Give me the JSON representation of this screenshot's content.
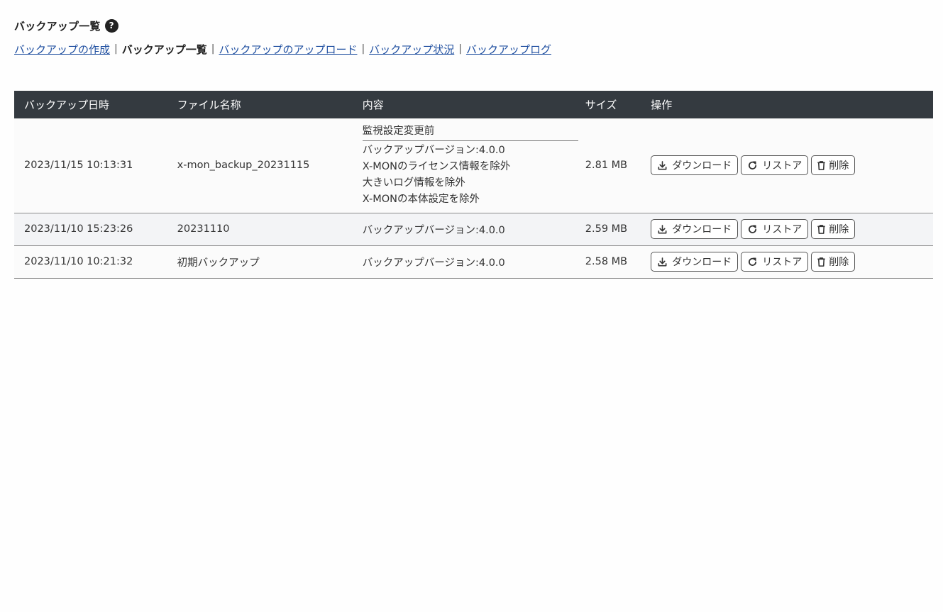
{
  "header": {
    "title": "バックアップ一覧",
    "help_symbol": "?"
  },
  "nav": {
    "separator": "|",
    "items": [
      {
        "label": "バックアップの作成",
        "current": false
      },
      {
        "label": "バックアップ一覧",
        "current": true
      },
      {
        "label": "バックアップのアップロード",
        "current": false
      },
      {
        "label": "バックアップ状況",
        "current": false
      },
      {
        "label": "バックアップログ",
        "current": false
      }
    ]
  },
  "table": {
    "columns": [
      "バックアップ日時",
      "ファイル名称",
      "内容",
      "サイズ",
      "操作"
    ],
    "rows": [
      {
        "datetime": "2023/11/15 10:13:31",
        "filename": "x-mon_backup_20231115",
        "memo": "監視設定変更前",
        "content": [
          "バックアップバージョン:4.0.0",
          "X-MONのライセンス情報を除外",
          "大きいログ情報を除外",
          "X-MONの本体設定を除外"
        ],
        "size": "2.81 MB"
      },
      {
        "datetime": "2023/11/10 15:23:26",
        "filename": "20231110",
        "memo": "",
        "content": [
          "バックアップバージョン:4.0.0"
        ],
        "size": "2.59 MB"
      },
      {
        "datetime": "2023/11/10 10:21:32",
        "filename": "初期バックアップ",
        "memo": "",
        "content": [
          "バックアップバージョン:4.0.0"
        ],
        "size": "2.58 MB"
      }
    ],
    "actions": {
      "download_label": "ダウンロード",
      "restore_label": "リストア",
      "delete_label": "削除"
    }
  },
  "icons": {
    "help": "help-circle-icon",
    "download": "download-icon",
    "restore": "restore-arrow-icon",
    "delete": "trash-icon"
  },
  "colors": {
    "header_bg": "#343a40",
    "link": "#1f4fa0",
    "row_alt": "#f3f4f6"
  }
}
